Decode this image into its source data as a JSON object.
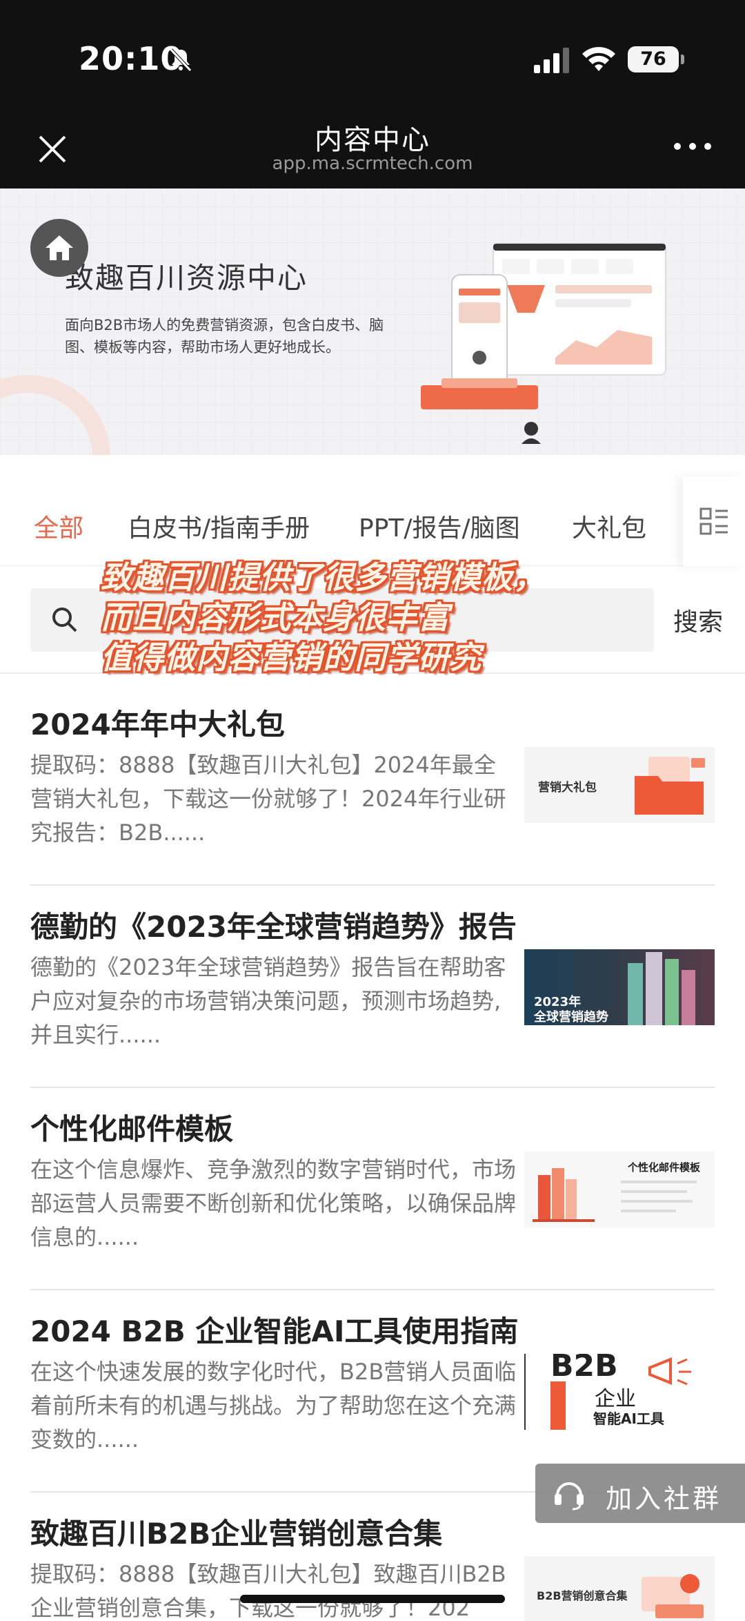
{
  "status_bar": {
    "time": "20:10",
    "battery": "76"
  },
  "navbar": {
    "title": "内容中心",
    "subtitle": "app.ma.scrmtech.com"
  },
  "banner": {
    "headline": "致趣百川资源中心",
    "description": "面向B2B市场人的免费营销资源，包含白皮书、脑图、模板等内容，帮助市场人更好地成长。"
  },
  "tabs": [
    {
      "label": "全部",
      "active": true
    },
    {
      "label": "白皮书/指南手册",
      "active": false
    },
    {
      "label": "PPT/报告/脑图",
      "active": false
    },
    {
      "label": "大礼包",
      "active": false
    }
  ],
  "search": {
    "value": "",
    "button_label": "搜索"
  },
  "caption_lines": [
    "致趣百川提供了很多营销模板，",
    "而且内容形式本身很丰富",
    "值得做内容营销的同学研究"
  ],
  "articles": [
    {
      "title": "2024年年中大礼包",
      "desc": "提取码：8888【致趣百川大礼包】2024年最全营销大礼包，下载这一份就够了！2024年行业研究报告：B2B......",
      "thumb_text": [
        "营销大礼包"
      ]
    },
    {
      "title": "德勤的《2023年全球营销趋势》报告",
      "desc": "德勤的《2023年全球营销趋势》报告旨在帮助客户应对复杂的市场营销决策问题，预测市场趋势,并且实行......",
      "thumb_text": [
        "2023年",
        "全球营销趋势"
      ]
    },
    {
      "title": "个性化邮件模板",
      "desc": "在这个信息爆炸、竞争激烈的数字营销时代，市场部运营人员需要不断创新和优化策略，以确保品牌信息的......",
      "thumb_text": [
        "个性化邮件模板"
      ]
    },
    {
      "title": "2024 B2B 企业智能AI工具使用指南",
      "desc": "在这个快速发展的数字化时代，B2B营销人员面临着前所未有的机遇与挑战。为了帮助您在这个充满变数的......",
      "thumb_text": [
        "B2B",
        "企业",
        "智能AI工具"
      ]
    },
    {
      "title": "致趣百川B2B企业营销创意合集",
      "desc": "提取码：8888【致趣百川大礼包】致趣百川B2B企业营销创意合集，下载这一份就够了！202",
      "thumb_text": [
        "B2B营销创意合集"
      ]
    }
  ],
  "join_button": {
    "label": "加入社群"
  },
  "colors": {
    "accent": "#e8674a",
    "caption_stroke": "#e4552e",
    "status_bg": "#111111"
  }
}
